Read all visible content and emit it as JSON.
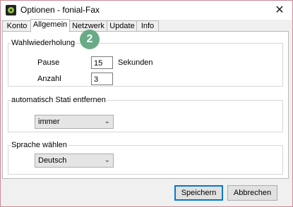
{
  "window": {
    "title": "Optionen - fonial-Fax",
    "close_glyph": "✕"
  },
  "tabs": [
    {
      "label": "Konto"
    },
    {
      "label": "Allgemein"
    },
    {
      "label": "Netzwerk"
    },
    {
      "label": "Update"
    },
    {
      "label": "Info"
    }
  ],
  "active_tab": "Allgemein",
  "badge": {
    "label": "2",
    "color": "#6aab87"
  },
  "redial": {
    "legend": "Wahlwiederholung",
    "pause_label": "Pause",
    "pause_value": "15",
    "pause_unit": "Sekunden",
    "count_label": "Anzahl",
    "count_value": "3"
  },
  "status": {
    "legend": "automatisch Stati entfernen",
    "selected": "immer"
  },
  "language": {
    "legend": "Sprache wählen",
    "selected": "Deutsch"
  },
  "buttons": {
    "save": "Speichern",
    "cancel": "Abbrechen"
  },
  "colors": {
    "accent": "#0078d7",
    "window_border": "#c88a95"
  },
  "icons": {
    "app": "fonial-fax-icon",
    "close": "close-icon",
    "dropdown": "chevron-down-icon"
  }
}
